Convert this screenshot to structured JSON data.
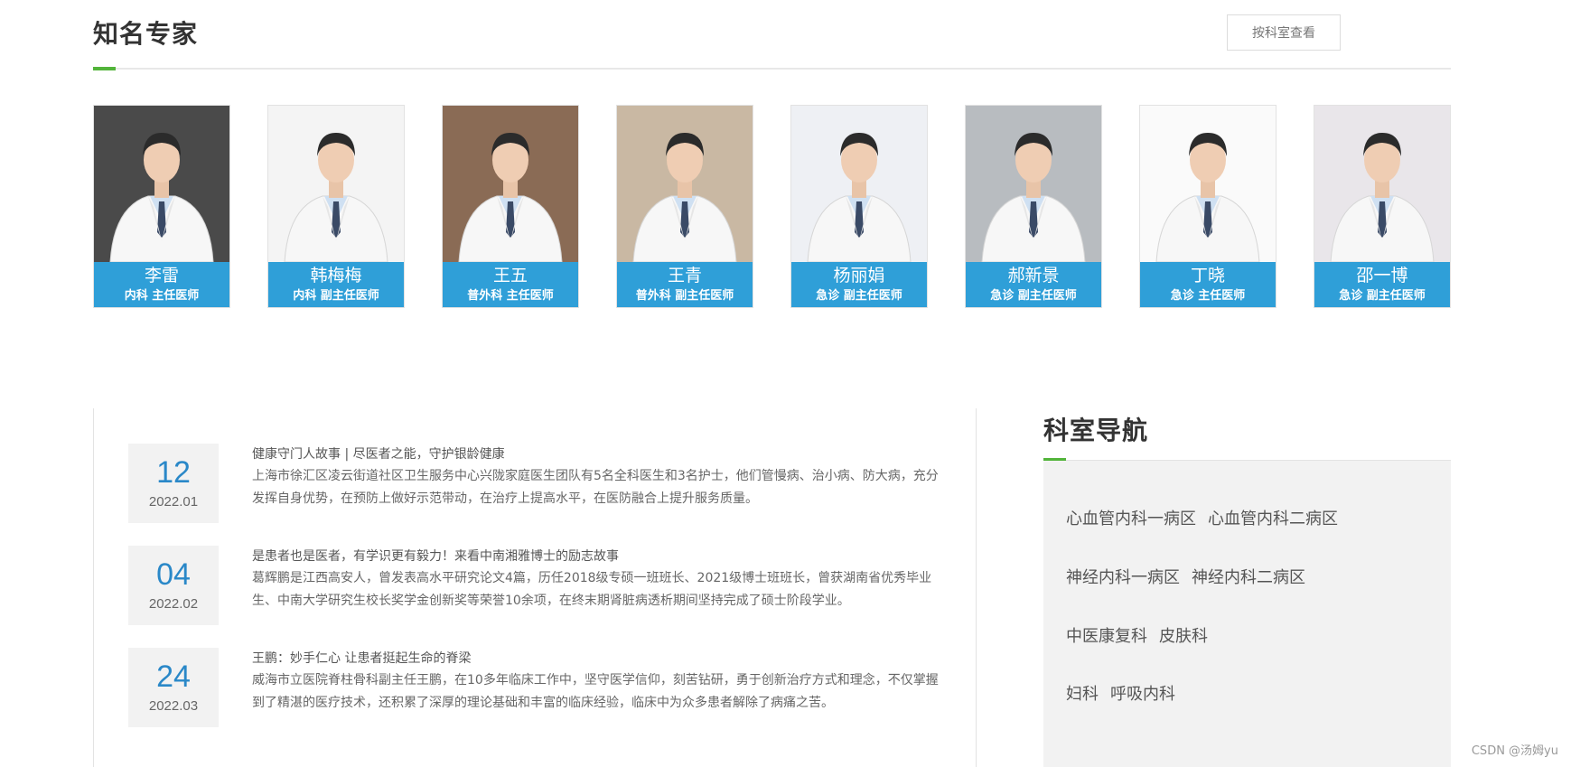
{
  "experts_section": {
    "title": "知名专家",
    "view_by_dept_label": "按科室查看"
  },
  "experts": [
    {
      "name": "李雷",
      "role": "内科 主任医师",
      "photo_bg": "#4a4a4a"
    },
    {
      "name": "韩梅梅",
      "role": "内科 副主任医师",
      "photo_bg": "#f4f4f4"
    },
    {
      "name": "王五",
      "role": "普外科 主任医师",
      "photo_bg": "#8a6b55"
    },
    {
      "name": "王青",
      "role": "普外科 副主任医师",
      "photo_bg": "#c9b8a3"
    },
    {
      "name": "杨丽娟",
      "role": "急诊 副主任医师",
      "photo_bg": "#eef0f4"
    },
    {
      "name": "郝新景",
      "role": "急诊 副主任医师",
      "photo_bg": "#b8bcc0"
    },
    {
      "name": "丁晓",
      "role": "急诊 主任医师",
      "photo_bg": "#fafafa"
    },
    {
      "name": "邵一博",
      "role": "急诊 副主任医师",
      "photo_bg": "#e9e6ea"
    }
  ],
  "news": [
    {
      "day": "12",
      "year_month": "2022.01",
      "title": "健康守门人故事 | 尽医者之能，守护银龄健康",
      "summary": "上海市徐汇区凌云街道社区卫生服务中心兴陇家庭医生团队有5名全科医生和3名护士，他们管慢病、治小病、防大病，充分发挥自身优势，在预防上做好示范带动，在治疗上提高水平，在医防融合上提升服务质量。"
    },
    {
      "day": "04",
      "year_month": "2022.02",
      "title": "是患者也是医者，有学识更有毅力！来看中南湘雅博士的励志故事",
      "summary": "葛辉鹏是江西高安人，曾发表高水平研究论文4篇，历任2018级专硕一班班长、2021级博士班班长，曾获湖南省优秀毕业生、中南大学研究生校长奖学金创新奖等荣誉10余项，在终末期肾脏病透析期间坚持完成了硕士阶段学业。"
    },
    {
      "day": "24",
      "year_month": "2022.03",
      "title": "王鹏：妙手仁心 让患者挺起生命的脊梁",
      "summary": "威海市立医院脊柱骨科副主任王鹏，在10多年临床工作中，坚守医学信仰，刻苦钻研，勇于创新治疗方式和理念，不仅掌握到了精湛的医疗技术，还积累了深厚的理论基础和丰富的临床经验，临床中为众多患者解除了病痛之苦。"
    }
  ],
  "dept_nav": {
    "title": "科室导航",
    "rows": [
      [
        "心血管内科一病区",
        "心血管内科二病区"
      ],
      [
        "神经内科一病区",
        "神经内科二病区"
      ],
      [
        "中医康复科",
        "皮肤科"
      ],
      [
        "妇科",
        "呼吸内科"
      ]
    ]
  },
  "watermark": "CSDN @汤姆yu",
  "colors": {
    "accent_green": "#52b43a",
    "caption_blue": "#2f9fd8",
    "date_blue": "#2a88c8"
  }
}
